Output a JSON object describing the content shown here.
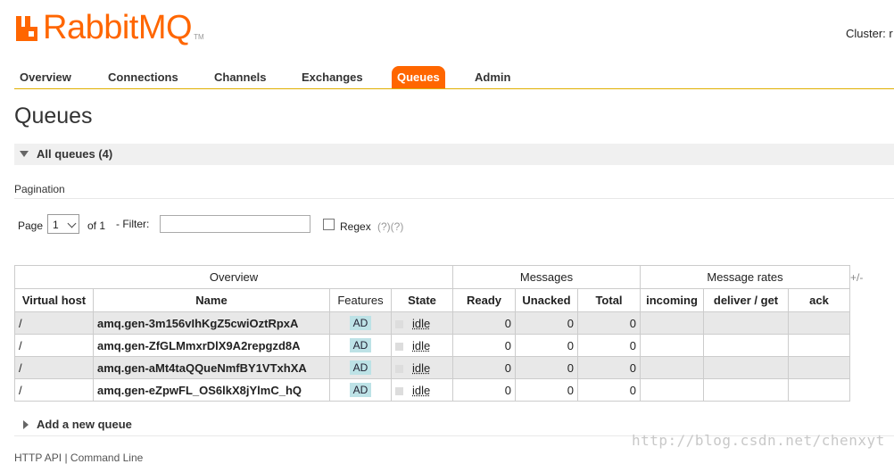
{
  "header": {
    "logo_text": "RabbitMQ",
    "logo_tm": "TM",
    "cluster_label": "Cluster: r",
    "brand_color": "#ff6600"
  },
  "nav": {
    "tabs": [
      {
        "label": "Overview",
        "active": false
      },
      {
        "label": "Connections",
        "active": false
      },
      {
        "label": "Channels",
        "active": false
      },
      {
        "label": "Exchanges",
        "active": false
      },
      {
        "label": "Queues",
        "active": true
      },
      {
        "label": "Admin",
        "active": false
      }
    ]
  },
  "page_title": "Queues",
  "section": {
    "label": "All queues (4)",
    "icon": "triangle-down-icon"
  },
  "pagination": {
    "heading": "Pagination",
    "page_label": "Page",
    "page_value": "1",
    "of_label": "of 1",
    "filter_label": "- Filter:",
    "filter_value": "",
    "regex_label": "Regex",
    "help_links": "(?)(?)"
  },
  "table": {
    "groups": [
      "Overview",
      "Messages",
      "Message rates"
    ],
    "plus_minus": "+/-",
    "columns": [
      "Virtual host",
      "Name",
      "Features",
      "State",
      "Ready",
      "Unacked",
      "Total",
      "incoming",
      "deliver / get",
      "ack"
    ],
    "rows": [
      {
        "vhost": "/",
        "name": "amq.gen-3m156vIhKgZ5cwiOztRpxA",
        "feature": "AD",
        "state": "idle",
        "ready": "0",
        "unacked": "0",
        "total": "0",
        "incoming": "",
        "deliver": "",
        "ack": ""
      },
      {
        "vhost": "/",
        "name": "amq.gen-ZfGLMmxrDlX9A2repgzd8A",
        "feature": "AD",
        "state": "idle",
        "ready": "0",
        "unacked": "0",
        "total": "0",
        "incoming": "",
        "deliver": "",
        "ack": ""
      },
      {
        "vhost": "/",
        "name": "amq.gen-aMt4taQQueNmfBY1VTxhXA",
        "feature": "AD",
        "state": "idle",
        "ready": "0",
        "unacked": "0",
        "total": "0",
        "incoming": "",
        "deliver": "",
        "ack": ""
      },
      {
        "vhost": "/",
        "name": "amq.gen-eZpwFL_OS6lkX8jYlmC_hQ",
        "feature": "AD",
        "state": "idle",
        "ready": "0",
        "unacked": "0",
        "total": "0",
        "incoming": "",
        "deliver": "",
        "ack": ""
      }
    ]
  },
  "add_queue": {
    "label": "Add a new queue",
    "icon": "triangle-right-icon"
  },
  "footer": {
    "text": "HTTP API | Command Line"
  },
  "watermark": "http://blog.csdn.net/chenxyt"
}
